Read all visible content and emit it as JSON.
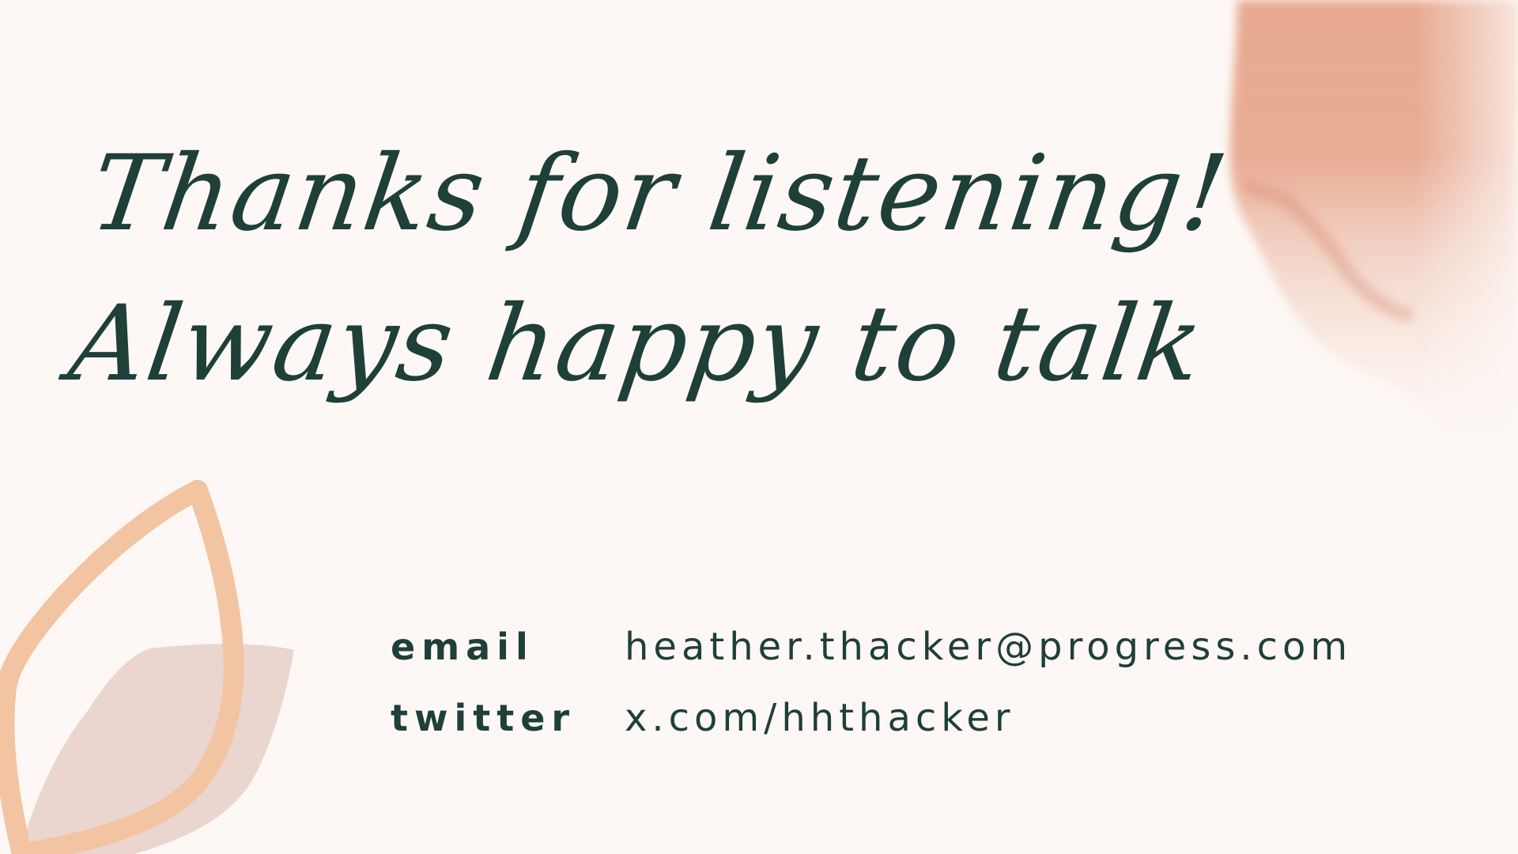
{
  "colors": {
    "background": "#fdf8f5",
    "text": "#1f3f39",
    "leaf_outline": "#f3c4a2",
    "leaf_fill": "#ead6cf",
    "watercolor": "#e49c80"
  },
  "headline": {
    "line1": "Thanks for listening!",
    "line2": "Always happy to talk"
  },
  "contact": {
    "rows": [
      {
        "label": "email",
        "value": "heather.thacker@progress.com"
      },
      {
        "label": "twitter",
        "value": "x.com/hhthacker"
      }
    ]
  },
  "decorations": {
    "top_right": "watercolor-brush-stroke",
    "bottom_left": "leaf-outline-icon"
  }
}
